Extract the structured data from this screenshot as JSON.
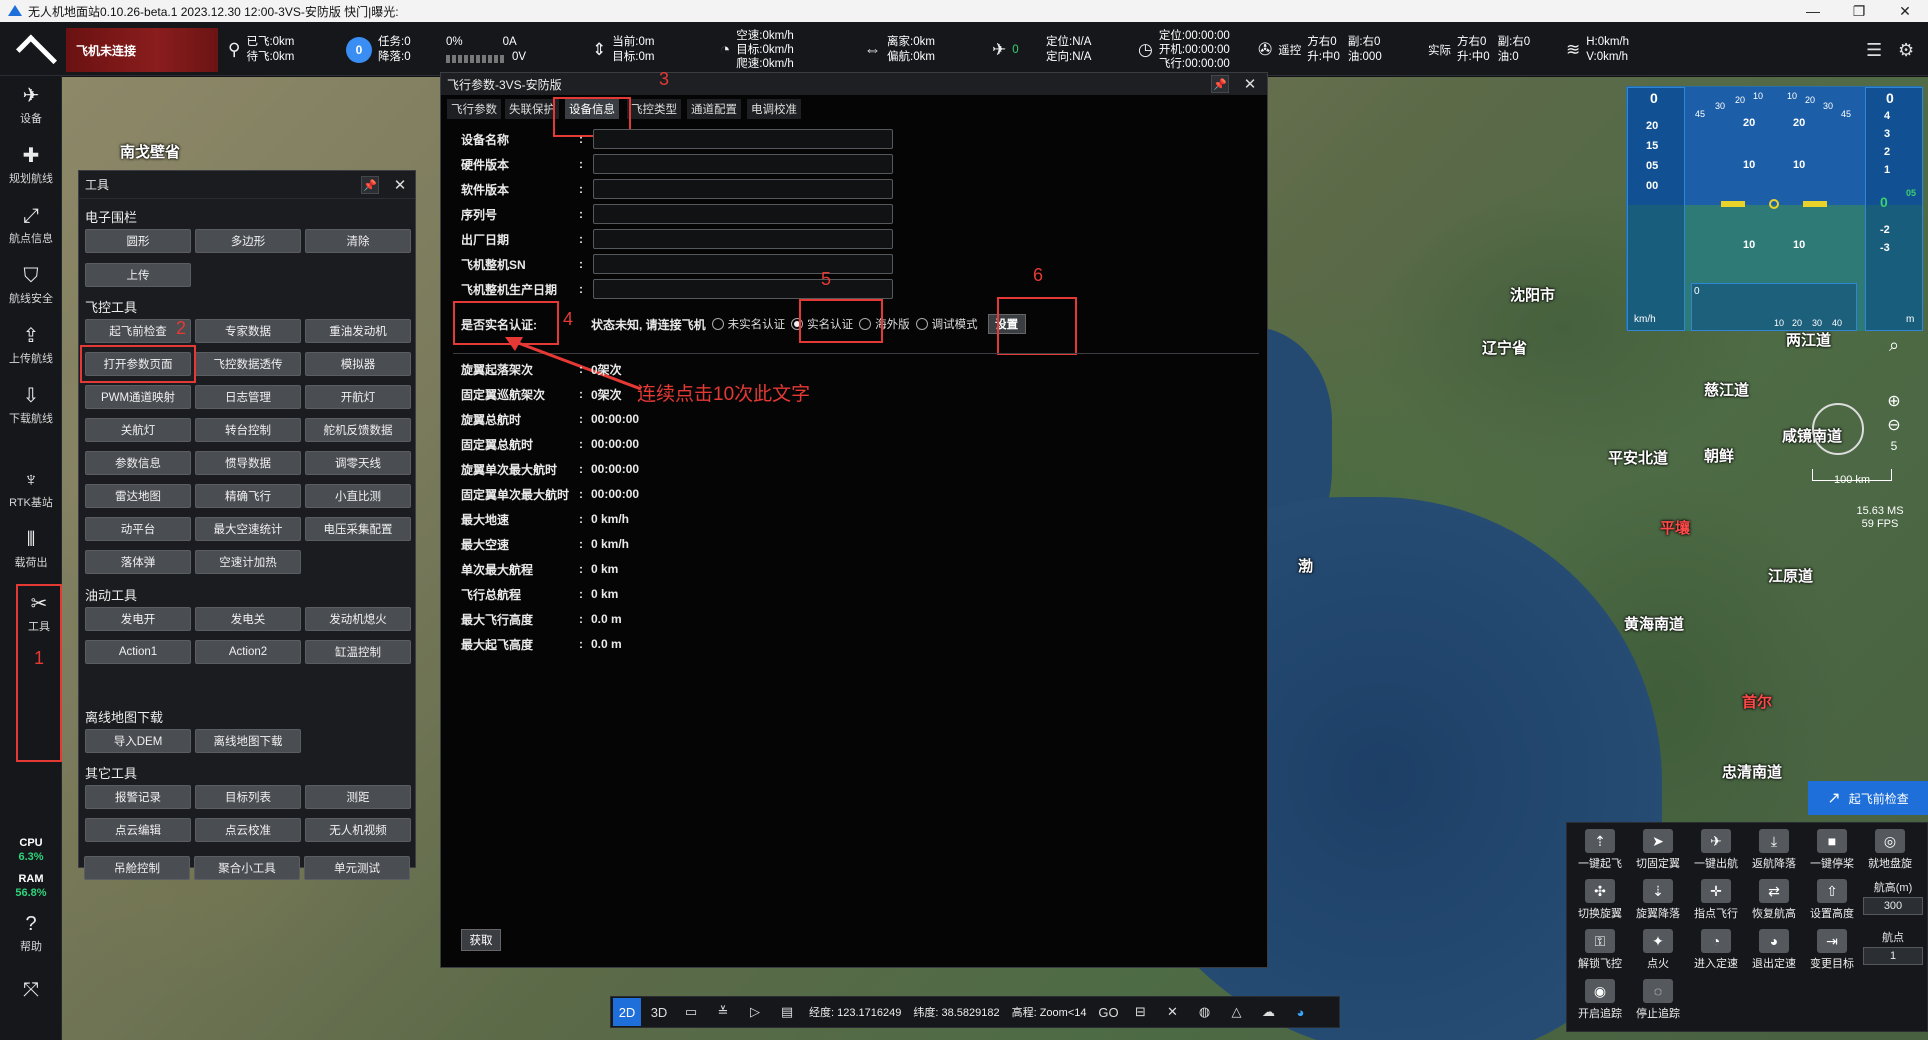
{
  "window": {
    "title": "无人机地面站0.10.26-beta.1 2023.12.30 12:00-3VS-安防版  快门|曝光:",
    "controls": [
      "—",
      "❐",
      "✕"
    ]
  },
  "topbar": {
    "connection": "飞机未连接",
    "distance": {
      "flown": "已飞:0km",
      "remaining": "待飞:0km"
    },
    "mission": {
      "badge": "0",
      "task": "任务:0",
      "land": "降落:0"
    },
    "battery": {
      "percent": "0%",
      "current": "0A",
      "voltage": "0V"
    },
    "altitude": {
      "current": "当前:0m",
      "target": "目标:0m"
    },
    "speed": {
      "air": "空速:0km/h",
      "target": "目标:0km/h",
      "climb": "爬速:0km/h"
    },
    "home": {
      "dist": "离家:0km",
      "offset": "偏航:0km"
    },
    "sats": "0",
    "position": {
      "loc": "定位:N/A",
      "dir": "定向:N/A"
    },
    "time": {
      "loc": "定位:00:00:00",
      "boot": "开机:00:00:00",
      "fly": "飞行:00:00:00"
    },
    "remote": {
      "label": "遥控",
      "a": "方右0",
      "b": "升:中0",
      "c": "副:右0",
      "d": "油:000"
    },
    "actual": {
      "label": "实际",
      "a": "方右0",
      "b": "升:中0",
      "c": "副:右0",
      "d": "油:0"
    },
    "wind": {
      "h": "H:0km/h",
      "v": "V:0km/h"
    }
  },
  "sidebar": {
    "items": [
      {
        "label": "设备",
        "icon": "plane-icon"
      },
      {
        "label": "规划航线",
        "icon": "plan-route-icon"
      },
      {
        "label": "航点信息",
        "icon": "waypoint-icon"
      },
      {
        "label": "航线安全",
        "icon": "shield-icon"
      },
      {
        "label": "上传航线",
        "icon": "upload-icon"
      },
      {
        "label": "下载航线",
        "icon": "download-icon"
      },
      {
        "label": "RTK基站",
        "icon": "rtk-icon"
      },
      {
        "label": "载荷出",
        "icon": "payload-icon"
      },
      {
        "label": "工具",
        "icon": "tools-icon"
      }
    ],
    "cpu_label": "CPU",
    "cpu_value": "6.3%",
    "ram_label": "RAM",
    "ram_value": "56.8%",
    "help": "帮助"
  },
  "tool_panel": {
    "title": "工具",
    "sections": {
      "fence": "电子围栏",
      "flight": "飞控工具",
      "oil": "油动工具",
      "offline": "离线地图下载",
      "other": "其它工具"
    },
    "fence_buttons": [
      "圆形",
      "多边形",
      "清除",
      "上传"
    ],
    "flight_buttons": [
      "起飞前检查",
      "专家数据",
      "重油发动机",
      "打开参数页面",
      "飞控数据透传",
      "模拟器",
      "PWM通道映射",
      "日志管理",
      "开航灯",
      "关航灯",
      "转台控制",
      "舵机反馈数据",
      "参数信息",
      "惯导数据",
      "调零天线",
      "雷达地图",
      "精确飞行",
      "小直比测",
      "动平台",
      "最大空速统计",
      "电压采集配置",
      "落体弹",
      "空速计加热"
    ],
    "oil_buttons": [
      "发电开",
      "发电关",
      "发动机熄火",
      "Action1",
      "Action2",
      "缸温控制"
    ],
    "offline_buttons": [
      "导入DEM",
      "离线地图下载"
    ],
    "other_buttons": [
      "报警记录",
      "目标列表",
      "测距",
      "点云编辑",
      "点云校准",
      "无人机视频",
      "吊舱控制",
      "聚合小工具",
      "单元测试"
    ]
  },
  "params_dialog": {
    "title": "飞行参数-3VS-安防版",
    "tabs": [
      "飞行参数",
      "失联保护",
      "设备信息",
      "飞控类型",
      "通道配置",
      "电调校准"
    ],
    "selected_tab": 2,
    "fields": [
      "设备名称",
      "硬件版本",
      "软件版本",
      "序列号",
      "出厂日期",
      "飞机整机SN",
      "飞机整机生产日期"
    ],
    "realname": {
      "label": "是否实名认证:",
      "status": "状态未知, 请连接飞机",
      "options": [
        "未实名认证",
        "实名认证",
        "海外版",
        "调试模式"
      ],
      "selected": 1,
      "set_button": "设置"
    },
    "stats": [
      {
        "label": "旋翼起落架次",
        "value": "0架次"
      },
      {
        "label": "固定翼巡航架次",
        "value": "0架次"
      },
      {
        "label": "旋翼总航时",
        "value": "00:00:00"
      },
      {
        "label": "固定翼总航时",
        "value": "00:00:00"
      },
      {
        "label": "旋翼单次最大航时",
        "value": "00:00:00"
      },
      {
        "label": "固定翼单次最大航时",
        "value": "00:00:00"
      },
      {
        "label": "最大地速",
        "value": "0 km/h"
      },
      {
        "label": "最大空速",
        "value": "0 km/h"
      },
      {
        "label": "单次最大航程",
        "value": "0 km"
      },
      {
        "label": "飞行总航程",
        "value": "0 km"
      },
      {
        "label": "最大飞行高度",
        "value": "0.0 m"
      },
      {
        "label": "最大起飞高度",
        "value": "0.0 m"
      }
    ],
    "get_button": "获取"
  },
  "annotations": {
    "n1": "1",
    "n2": "2",
    "n3": "3",
    "n4": "4",
    "n5": "5",
    "n6": "6",
    "hint": "连续点击10次此文字"
  },
  "map": {
    "labels": [
      "南戈壁省",
      "沈阳市",
      "辽宁省",
      "两江道",
      "慈江道",
      "平安北道",
      "咸镜南道",
      "朝鲜",
      "平壤",
      "江原道",
      "黄海南道",
      "首尔",
      "忠清南道",
      "渤"
    ],
    "scale": "100 km",
    "zoom_level": "5",
    "render_stats": "15.63 MS 59 FPS",
    "preflight_button": "起飞前检查"
  },
  "hud": {
    "left_top": "0",
    "right_top": "0",
    "left_ticks": [
      "20",
      "15",
      "05",
      "00"
    ],
    "right_ticks": [
      "4",
      "3",
      "2",
      "1",
      "0",
      "-2",
      "-3"
    ],
    "pitch": [
      "20",
      "10",
      "10"
    ],
    "roll": [
      "45",
      "30",
      "20",
      "10",
      "10",
      "20",
      "30",
      "45"
    ],
    "left_unit": "km/h",
    "right_unit": "m",
    "heading": [
      "0",
      "10",
      "20",
      "30",
      "40"
    ],
    "vsi": "05"
  },
  "control_panel": {
    "buttons": [
      "一键起飞",
      "切固定翼",
      "一键出航",
      "返航降落",
      "一键停桨",
      "就地盘旋",
      "切换旋翼",
      "旋翼降落",
      "指点飞行",
      "恢复航高",
      "设置高度",
      "解锁飞控",
      "点火",
      "进入定速",
      "退出定速",
      "变更目标",
      "开启追踪",
      "停止追踪"
    ],
    "altitude_label": "航高(m)",
    "altitude_value": "300",
    "waypoint_label": "航点",
    "waypoint_value": "1"
  },
  "bottom_bar": {
    "modes": [
      "2D",
      "3D"
    ],
    "lon": "经度: 123.1716249",
    "lat": "纬度: 38.5829182",
    "alt": "高程: Zoom<14",
    "go": "GO"
  },
  "colors": {
    "accent": "#1e6fd9",
    "warning_red": "#e53935",
    "cpu_green": "#2fd37a"
  }
}
